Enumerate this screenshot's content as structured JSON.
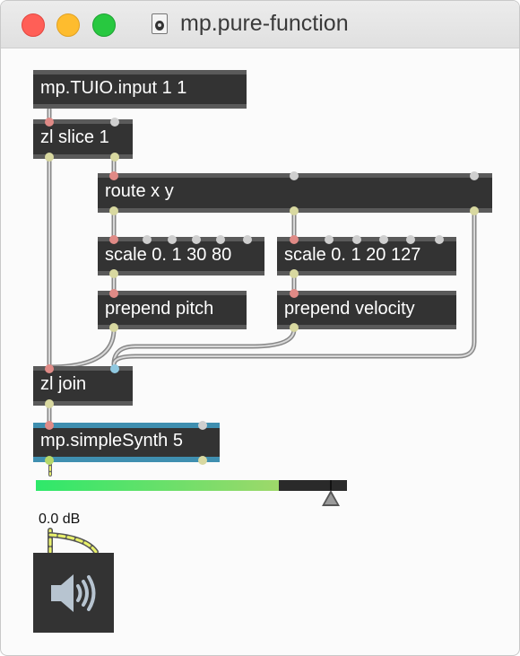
{
  "window": {
    "title": "mp.pure-function",
    "doc_icon": "speaker-document-icon"
  },
  "objects": {
    "tuio": "mp.TUIO.input 1 1",
    "slice": "zl slice 1",
    "route": "route x y",
    "scale_pitch": "scale 0. 1 30 80",
    "scale_velocity": "scale 0. 1 20 127",
    "prepend_pitch": "prepend pitch",
    "prepend_velocity": "prepend velocity",
    "join": "zl join",
    "synth": "mp.simpleSynth 5"
  },
  "gain": {
    "label": "0.0 dB",
    "level": 0.78
  },
  "dac": {
    "icon": "speaker-volume-icon"
  },
  "colors": {
    "object_bg": "#333333",
    "message_inlet": "#e08a86",
    "signal_outlet": "#b6d86a",
    "synth_accent": "#3f8fb0",
    "meter_green": "#2ee86a"
  }
}
